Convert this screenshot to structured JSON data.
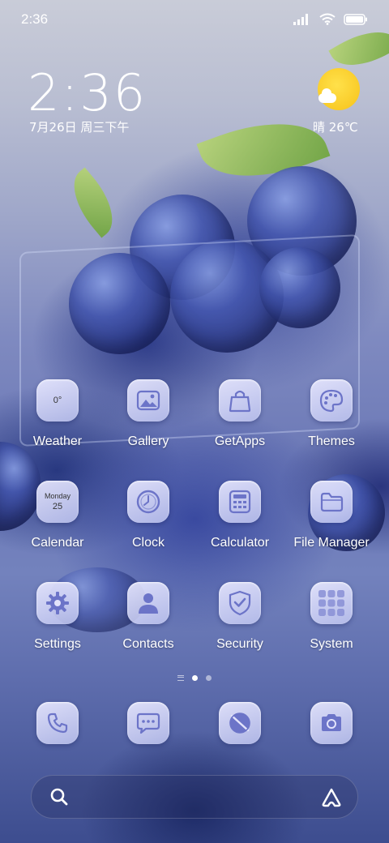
{
  "status_bar": {
    "time": "2:36"
  },
  "lock_widget": {
    "big_time": "2:36",
    "date": "7月26日 周三下午",
    "weather": "晴 26℃"
  },
  "apps": [
    {
      "label": "Weather",
      "icon": "weather-icon",
      "icon_text": "0°"
    },
    {
      "label": "Gallery",
      "icon": "gallery-icon"
    },
    {
      "label": "GetApps",
      "icon": "shopping-bag-icon"
    },
    {
      "label": "Themes",
      "icon": "palette-icon"
    },
    {
      "label": "Calendar",
      "icon": "calendar-icon",
      "icon_day": "Monday",
      "icon_date": "25"
    },
    {
      "label": "Clock",
      "icon": "clock-icon"
    },
    {
      "label": "Calculator",
      "icon": "calculator-icon"
    },
    {
      "label": "File Manager",
      "icon": "folder-icon"
    },
    {
      "label": "Settings",
      "icon": "gear-icon"
    },
    {
      "label": "Contacts",
      "icon": "person-icon"
    },
    {
      "label": "Security",
      "icon": "shield-check-icon"
    },
    {
      "label": "System",
      "icon": "app-folder-icon"
    }
  ],
  "dock": [
    {
      "icon": "phone-icon"
    },
    {
      "icon": "message-icon"
    },
    {
      "icon": "browser-icon"
    },
    {
      "icon": "camera-icon"
    }
  ],
  "page_indicator": {
    "pages": 2,
    "active": 1
  },
  "colors": {
    "icon_glyph": "#6c74c8",
    "sun": "#f7c21a"
  }
}
